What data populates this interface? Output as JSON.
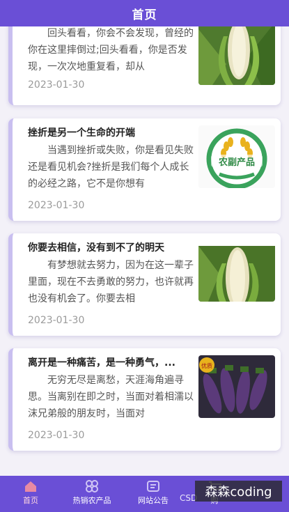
{
  "header": {
    "title": "首页"
  },
  "articles": [
    {
      "title": "",
      "body": "回头看看，你会不会发现，曾经的你在这里摔倒过;回头看看，你是否发现，一次次地重复看，却从",
      "date": "2023-01-30",
      "image": "corn-photo"
    },
    {
      "title": "挫折是另一个生命的开端",
      "body": "当遇到挫折或失败，你是看见失败还是看见机会?挫折是我们每个人成长的必经之路，它不是你想有",
      "date": "2023-01-30",
      "image": "farm-products-logo",
      "logo_text": "农副产品"
    },
    {
      "title": "你要去相信，没有到不了的明天",
      "body": "有梦想就去努力，因为在这一辈子里面，现在不去勇敢的努力，也许就再也没有机会了。你要去相",
      "date": "2023-01-30",
      "image": "corn-photo"
    },
    {
      "title": "离开是一种痛苦，是一种勇气，...",
      "body": "无穷无尽是离愁，天涯海角遍寻思。当离别在即之时，当面对着相濡以沫兄弟般的朋友时，当面对",
      "date": "2023-01-30",
      "image": "eggplant-photo",
      "badge": "优质"
    }
  ],
  "tabbar": {
    "items": [
      {
        "label": "首页",
        "icon": "home-icon"
      },
      {
        "label": "热销农产品",
        "icon": "grid-icon"
      },
      {
        "label": "网站公告",
        "icon": "announcement-icon"
      },
      {
        "label": "购",
        "icon": "cart-icon"
      }
    ]
  },
  "watermark": {
    "text": "森森coding",
    "csdn": "CSD"
  },
  "colors": {
    "accent": "#6a4fd6",
    "card_border": "#c9bff0"
  }
}
